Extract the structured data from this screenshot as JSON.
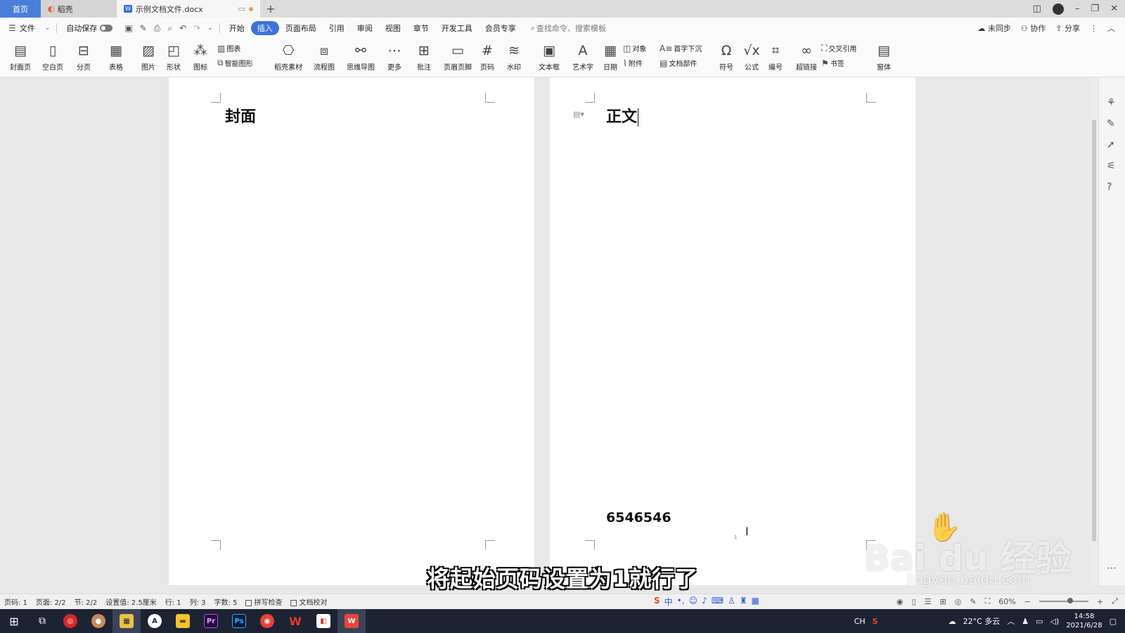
{
  "tabs": {
    "home": "首页",
    "daoke": "稻壳",
    "doc": "示例文档文件.docx",
    "add": "+"
  },
  "menu": {
    "file": "文件",
    "autosave": "自动保存",
    "items": [
      "开始",
      "插入",
      "页面布局",
      "引用",
      "审阅",
      "视图",
      "章节",
      "开发工具",
      "会员专享"
    ],
    "active_index": 1,
    "search_placeholder": "查找命令、搜索模板",
    "sync": "未同步",
    "collab": "协作",
    "share": "分享"
  },
  "ribbon": {
    "cover": "封面页",
    "blank": "空白页",
    "pagebreak": "分页",
    "table": "表格",
    "picture": "图片",
    "shape": "形状",
    "icon": "图标",
    "chart": "图表",
    "smartart": "智能图形",
    "material": "稻壳素材",
    "flowchart": "流程图",
    "mindmap": "思维导图",
    "more": "更多",
    "comment": "批注",
    "header_footer": "页眉页脚",
    "page_number": "页码",
    "watermark": "水印",
    "textbox": "文本框",
    "wordart": "艺术字",
    "date": "日期",
    "object": "对象",
    "attachment": "附件",
    "dropcap": "首字下沉",
    "docparts": "文档部件",
    "symbol": "符号",
    "formula": "公式",
    "numbering": "编号",
    "hyperlink": "超链接",
    "crossref": "交叉引用",
    "bookmark": "书签",
    "font": "窗体"
  },
  "document": {
    "page1_heading": "封面",
    "page2_heading": "正文",
    "footer_number": "6546546",
    "footer_small": "1"
  },
  "subtitle": "将起始页码设置为1就行了",
  "watermark": {
    "brand": "Bai du 经验",
    "url": "jingyan.baidu.com"
  },
  "status": {
    "pageno": "页码: 1",
    "pages": "页面: 2/2",
    "section": "节: 2/2",
    "setting": "设置值: 2.5厘米",
    "row": "行: 1",
    "col": "列: 3",
    "words": "字数: 5",
    "spell": "拼写检查",
    "proof": "文档校对",
    "zoom": "60%"
  },
  "taskbar": {
    "weather": "22°C 多云",
    "lang": "CH",
    "time": "14:58",
    "date": "2021/6/28"
  },
  "colors": {
    "accent": "#3a74d8",
    "taskbar": "#1c2333"
  }
}
